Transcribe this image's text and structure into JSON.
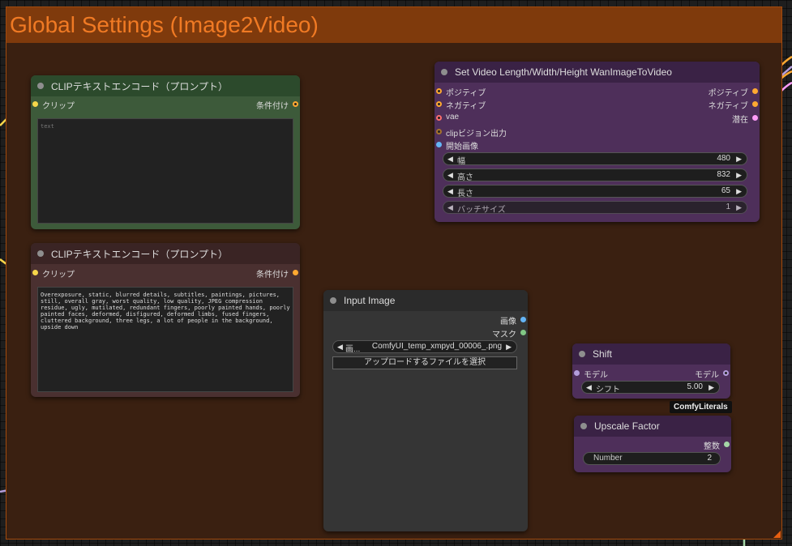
{
  "group": {
    "title": "Global Settings (Image2Video)"
  },
  "nodes": {
    "clip_positive": {
      "title": "CLIPテキストエンコード（プロンプト）",
      "input_label": "クリップ",
      "output_label": "条件付け",
      "text_placeholder": "text",
      "text_value": ""
    },
    "clip_negative": {
      "title": "CLIPテキストエンコード（プロンプト）",
      "input_label": "クリップ",
      "output_label": "条件付け",
      "text_value": "Overexposure, static, blurred details, subtitles, paintings, pictures, still, overall gray, worst quality, low quality, JPEG compression residue, ugly, mutilated, redundant fingers, poorly painted hands, poorly painted faces, deformed, disfigured, deformed limbs, fused fingers, cluttered background, three legs, a lot of people in the background, upside down"
    },
    "wan_video": {
      "title": "Set Video Length/Width/Height WanImageToVideo",
      "inputs": [
        "ポジティブ",
        "ネガティブ",
        "vae",
        "clipビジョン出力",
        "開始画像"
      ],
      "outputs": [
        "ポジティブ",
        "ネガティブ",
        "潜在"
      ],
      "widgets": [
        {
          "label": "幅",
          "value": "480"
        },
        {
          "label": "高さ",
          "value": "832"
        },
        {
          "label": "長さ",
          "value": "65"
        },
        {
          "label": "バッチサイズ",
          "value": "1"
        }
      ]
    },
    "input_image": {
      "title": "Input Image",
      "outputs": [
        "画像",
        "マスク"
      ],
      "image_widget": {
        "label": "画...",
        "value": "ComfyUI_temp_xmpyd_00006_.png"
      },
      "upload_button": "アップロードするファイルを選択"
    },
    "shift": {
      "title": "Shift",
      "input_label": "モデル",
      "output_label": "モデル",
      "widget": {
        "label": "シフト",
        "value": "5.00"
      },
      "badge": "ComfyLiterals"
    },
    "upscale": {
      "title": "Upscale Factor",
      "output_label": "整数",
      "widget": {
        "label": "Number",
        "value": "2"
      }
    }
  },
  "colors": {
    "group_bg": "#3a2011",
    "group_header": "#7f3a0c",
    "group_title": "#f07a24",
    "clip_port": "#f6d64a",
    "conditioning_port": "#ffa931",
    "vae_port": "#ff6e6e",
    "clip_vision_port": "#a8732d",
    "image_port": "#64b5f6",
    "mask_port": "#81c784",
    "model_port": "#b39ddb",
    "latent_port": "#ff9cf9",
    "int_port": "#a5d6a7"
  }
}
